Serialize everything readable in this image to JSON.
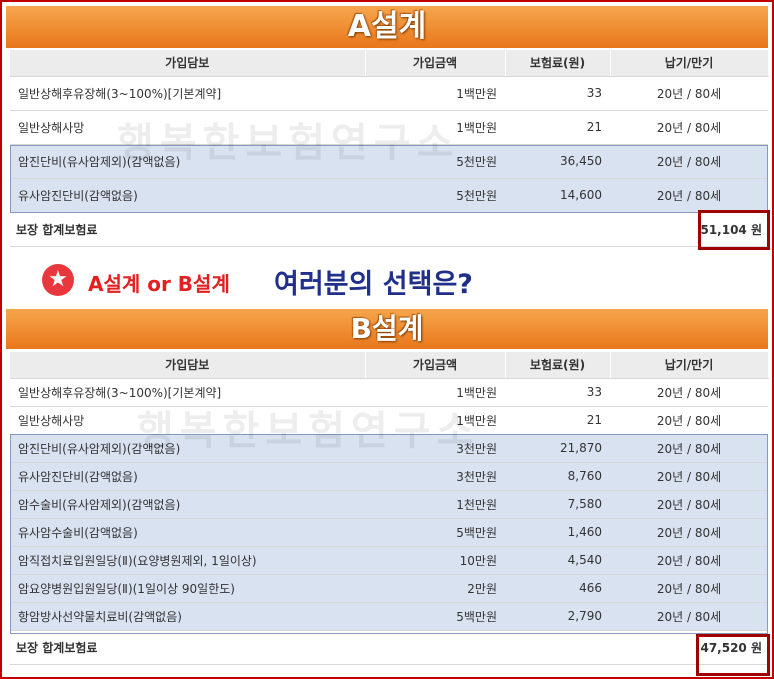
{
  "plan_a": {
    "title": "A설계",
    "headers": [
      "가입담보",
      "가입금액",
      "보험료(원)",
      "납기/만기"
    ],
    "rows": [
      {
        "name": "일반상해후유장해(3~100%)[기본계약]",
        "amount": "1백만원",
        "premium": "33",
        "term": "20년 / 80세"
      },
      {
        "name": "일반상해사망",
        "amount": "1백만원",
        "premium": "21",
        "term": "20년 / 80세"
      },
      {
        "name": "암진단비(유사암제외)(감액없음)",
        "amount": "5천만원",
        "premium": "36,450",
        "term": "20년 / 80세"
      },
      {
        "name": "유사암진단비(감액없음)",
        "amount": "5천만원",
        "premium": "14,600",
        "term": "20년 / 80세"
      }
    ],
    "total_label": "보장 합계보험료",
    "total_value": "51,104 원"
  },
  "question": {
    "star": "★",
    "choice": "A설계 or B설계",
    "text": "여러분의 선택은?"
  },
  "plan_b": {
    "title": "B설계",
    "headers": [
      "가입담보",
      "가입금액",
      "보험료(원)",
      "납기/만기"
    ],
    "rows": [
      {
        "name": "일반상해후유장해(3~100%)[기본계약]",
        "amount": "1백만원",
        "premium": "33",
        "term": "20년 / 80세"
      },
      {
        "name": "일반상해사망",
        "amount": "1백만원",
        "premium": "21",
        "term": "20년 / 80세"
      },
      {
        "name": "암진단비(유사암제외)(감액없음)",
        "amount": "3천만원",
        "premium": "21,870",
        "term": "20년 / 80세"
      },
      {
        "name": "유사암진단비(감액없음)",
        "amount": "3천만원",
        "premium": "8,760",
        "term": "20년 / 80세"
      },
      {
        "name": "암수술비(유사암제외)(감액없음)",
        "amount": "1천만원",
        "premium": "7,580",
        "term": "20년 / 80세"
      },
      {
        "name": "유사암수술비(감액없음)",
        "amount": "5백만원",
        "premium": "1,460",
        "term": "20년 / 80세"
      },
      {
        "name": "암직접치료입원일당(Ⅱ)(요양병원제외, 1일이상)",
        "amount": "10만원",
        "premium": "4,540",
        "term": "20년 / 80세"
      },
      {
        "name": "암요양병원입원일당(Ⅱ)(1일이상 90일한도)",
        "amount": "2만원",
        "premium": "466",
        "term": "20년 / 80세"
      },
      {
        "name": "항암방사선약물치료비(감액없음)",
        "amount": "5백만원",
        "premium": "2,790",
        "term": "20년 / 80세"
      }
    ],
    "total_label": "보장 합계보험료",
    "total_value": "47,520 원"
  },
  "watermark": "행복한보험연구소",
  "colors": {
    "banner": "#ef8a2c",
    "highlight_row": "#d9e2f1",
    "total_border": "#a00000",
    "question_choice": "#e22020",
    "question_text": "#1f2f8a"
  }
}
